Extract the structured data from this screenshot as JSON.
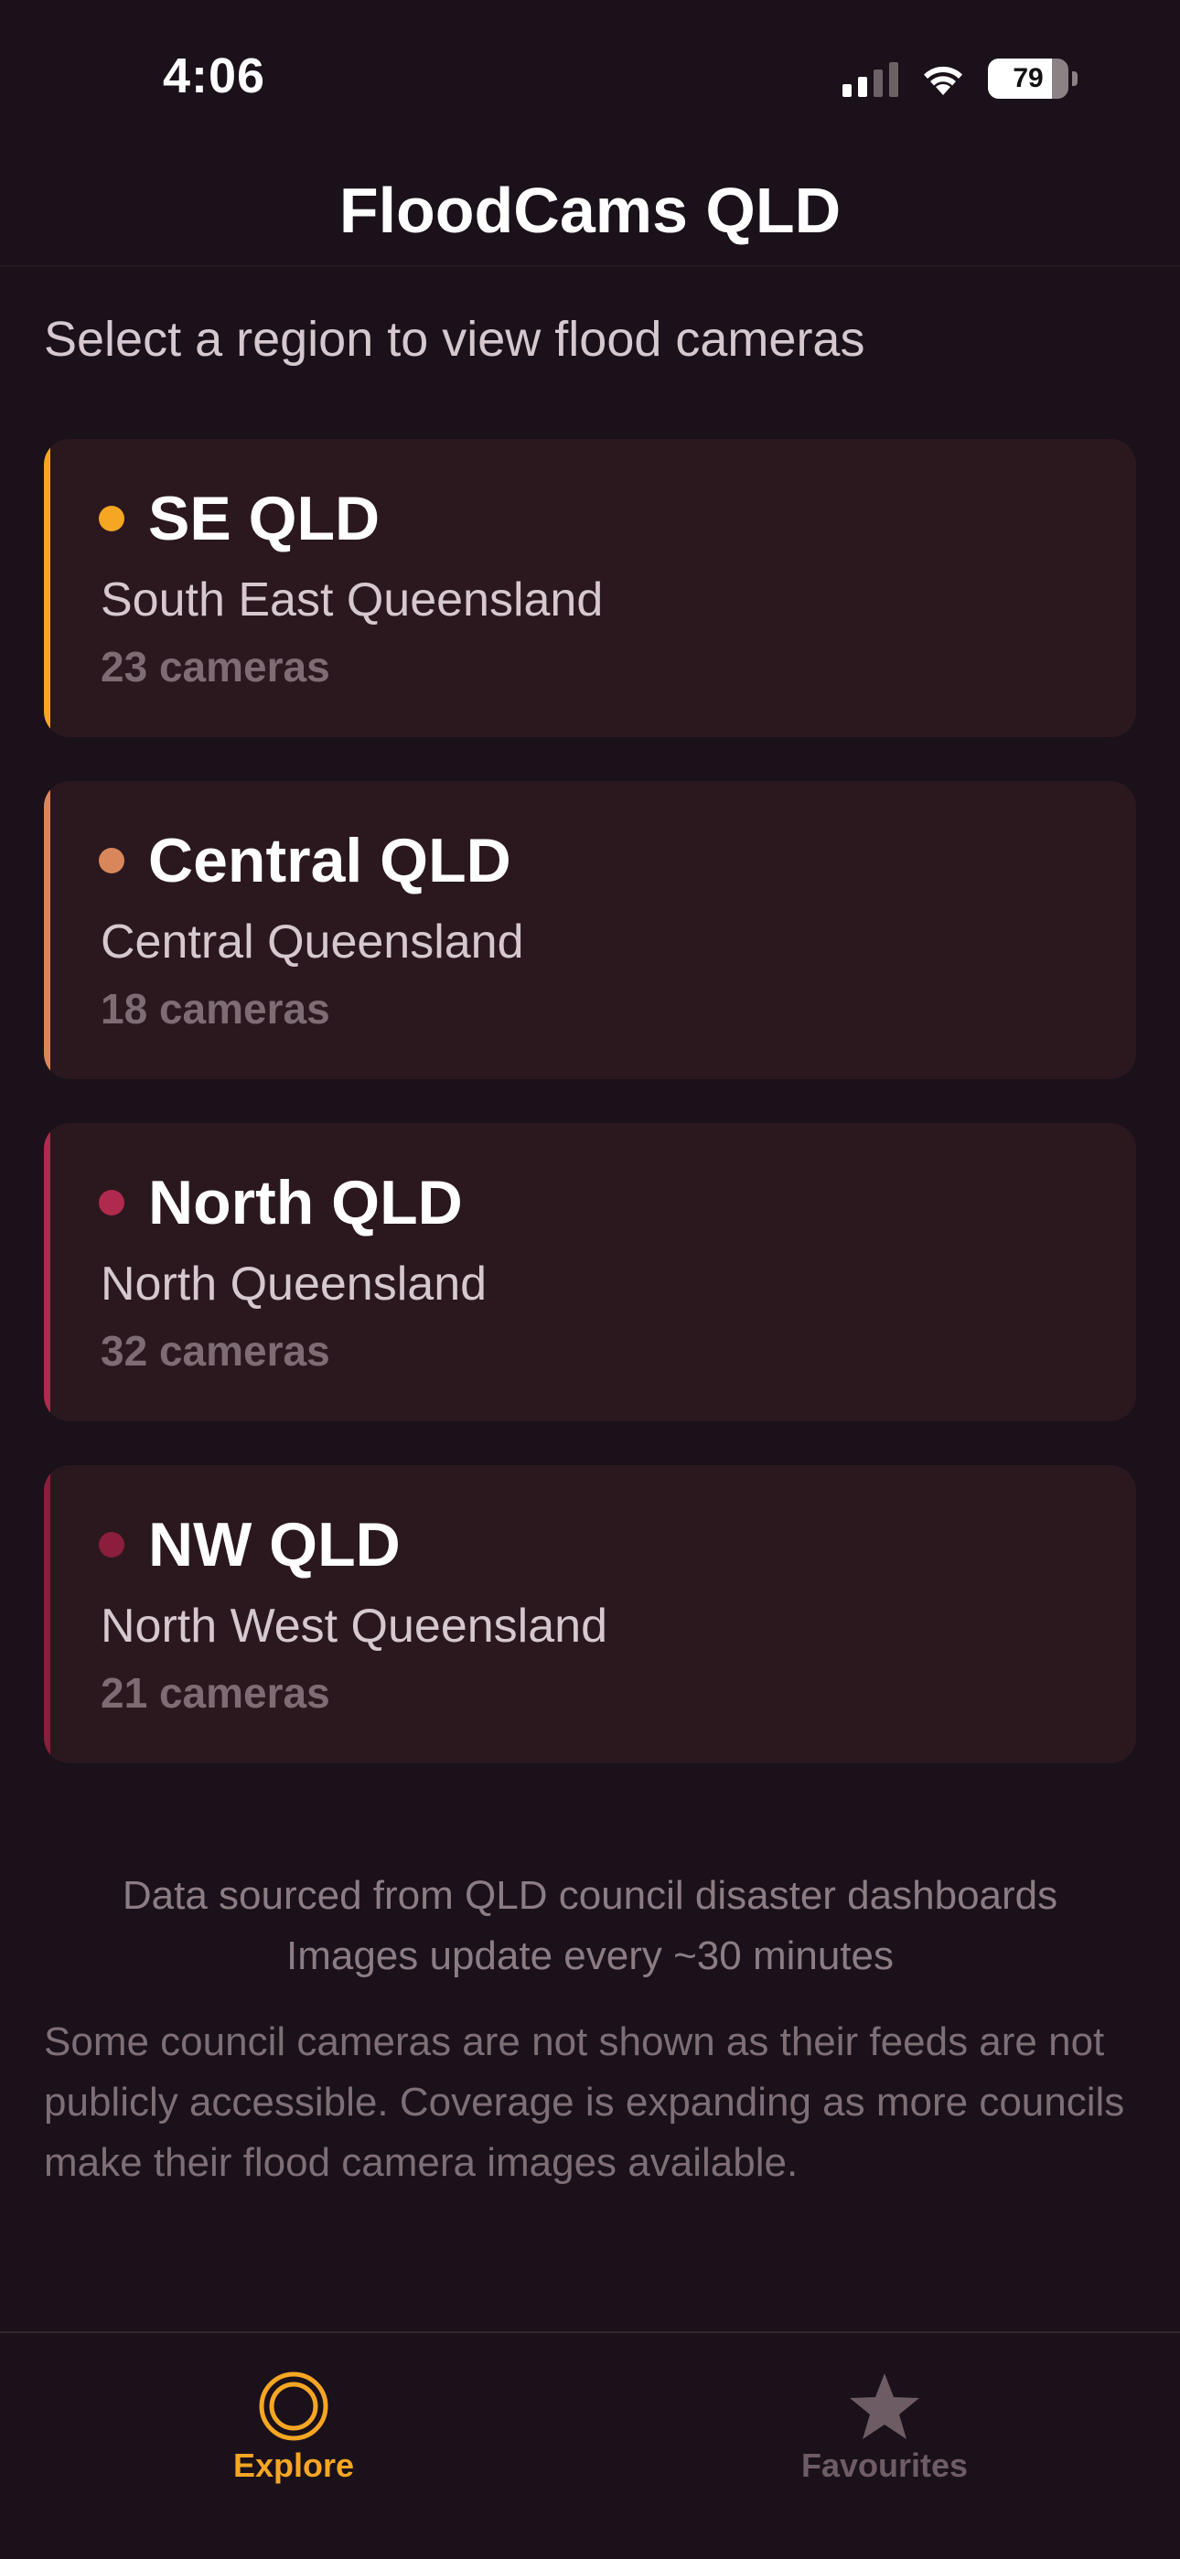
{
  "status_bar": {
    "time": "4:06",
    "battery_level": "79",
    "battery_fraction": 0.79,
    "signal_bars_active": 2,
    "signal_bars_total": 4
  },
  "header": {
    "title": "FloodCams QLD"
  },
  "subtitle": "Select a region to view flood cameras",
  "regions": [
    {
      "name": "SE QLD",
      "full_name": "South East Queensland",
      "count": "23 cameras",
      "color": "#f5a623"
    },
    {
      "name": "Central QLD",
      "full_name": "Central Queensland",
      "count": "18 cameras",
      "color": "#d9875a"
    },
    {
      "name": "North QLD",
      "full_name": "North Queensland",
      "count": "32 cameras",
      "color": "#b02a4e"
    },
    {
      "name": "NW QLD",
      "full_name": "North West Queensland",
      "count": "21 cameras",
      "color": "#8a1e3c"
    }
  ],
  "footer": {
    "source_line1": "Data sourced from QLD council disaster dashboards",
    "source_line2": "Images update every ~30 minutes",
    "disclaimer": "Some council cameras are not shown as their feeds are not publicly accessible. Coverage is expanding as more councils make their flood camera images available."
  },
  "tab_bar": {
    "tabs": [
      {
        "label": "Explore",
        "icon": "explore-icon",
        "active": true,
        "color": "#f5a623"
      },
      {
        "label": "Favourites",
        "icon": "star-icon",
        "active": false,
        "color": "#6e5c65"
      }
    ]
  }
}
